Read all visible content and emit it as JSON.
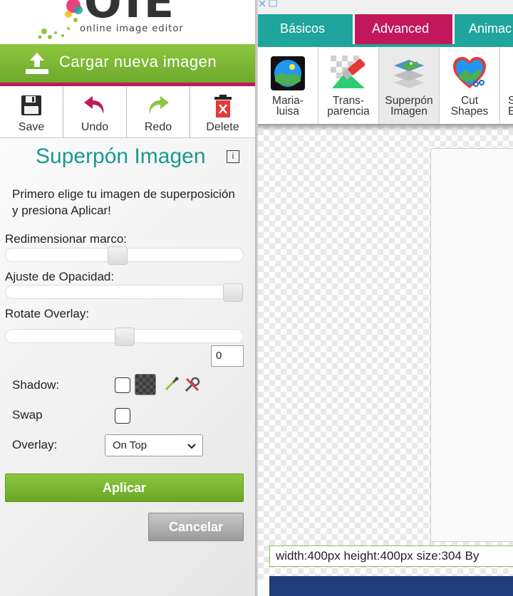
{
  "brand": {
    "logo_letters": "OIE",
    "tagline": "online image editor"
  },
  "upload": {
    "label": "Cargar nueva imagen"
  },
  "toolbar": {
    "save": "Save",
    "undo": "Undo",
    "redo": "Redo",
    "delete": "Delete"
  },
  "panel": {
    "title": "Superpón Imagen",
    "info_icon": "i",
    "instructions": "Primero elige tu imagen de superposición y presiona Aplicar!"
  },
  "fields": {
    "resize_label": "Redimensionar marco:",
    "resize_value": 0.47,
    "opacity_label": "Ajuste de Opacidad:",
    "opacity_value": 1.0,
    "rotate_label": "Rotate Overlay:",
    "rotate_value": "0",
    "shadow_label": "Shadow:",
    "shadow_checked": false,
    "swap_label": "Swap",
    "swap_checked": false,
    "overlay_label": "Overlay:",
    "overlay_selected": "On Top"
  },
  "actions": {
    "apply": "Aplicar",
    "cancel": "Cancelar"
  },
  "tabs": [
    {
      "label": "Básicos",
      "active": false
    },
    {
      "label": "Advanced",
      "active": true
    },
    {
      "label": "Animac",
      "active": false
    }
  ],
  "advanced_tools": [
    {
      "label1": "Maria-",
      "label2": "luisa",
      "icon": "landscape-frame-icon",
      "active": false
    },
    {
      "label1": "Trans-",
      "label2": "parencia",
      "icon": "eraser-icon",
      "active": false
    },
    {
      "label1": "Superpón",
      "label2": "Imagen",
      "icon": "layers-icon",
      "active": true
    },
    {
      "label1": "Cut",
      "label2": "Shapes",
      "icon": "heart-scissors-icon",
      "active": false
    },
    {
      "label1": "S",
      "label2": "E",
      "icon": "partial-tool-icon",
      "active": false
    }
  ],
  "status": {
    "info": "width:400px  height:400px  size:304 By"
  },
  "colors": {
    "green": "#8ec63f",
    "magenta": "#c2185b",
    "teal": "#1fa59b",
    "title_teal": "#1a9a8f"
  }
}
